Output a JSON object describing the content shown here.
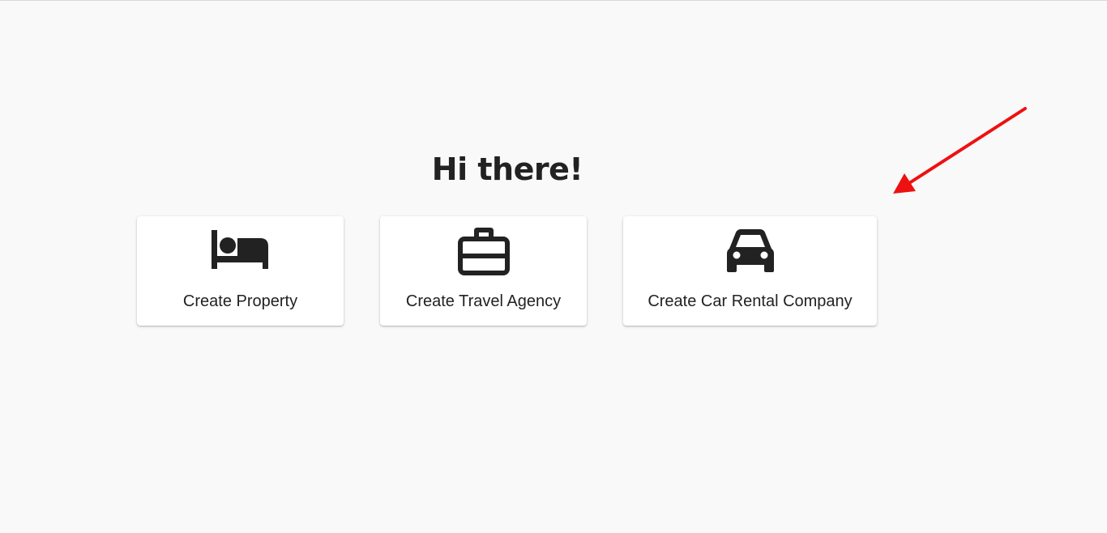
{
  "greeting": "Hi there!",
  "cards": [
    {
      "label": "Create Property",
      "icon": "bed-icon"
    },
    {
      "label": "Create Travel Agency",
      "icon": "briefcase-icon"
    },
    {
      "label": "Create Car Rental Company",
      "icon": "car-icon"
    }
  ],
  "colors": {
    "background": "#f9f9f9",
    "card": "#ffffff",
    "text": "#222222",
    "annotation_arrow": "#ee1111"
  }
}
